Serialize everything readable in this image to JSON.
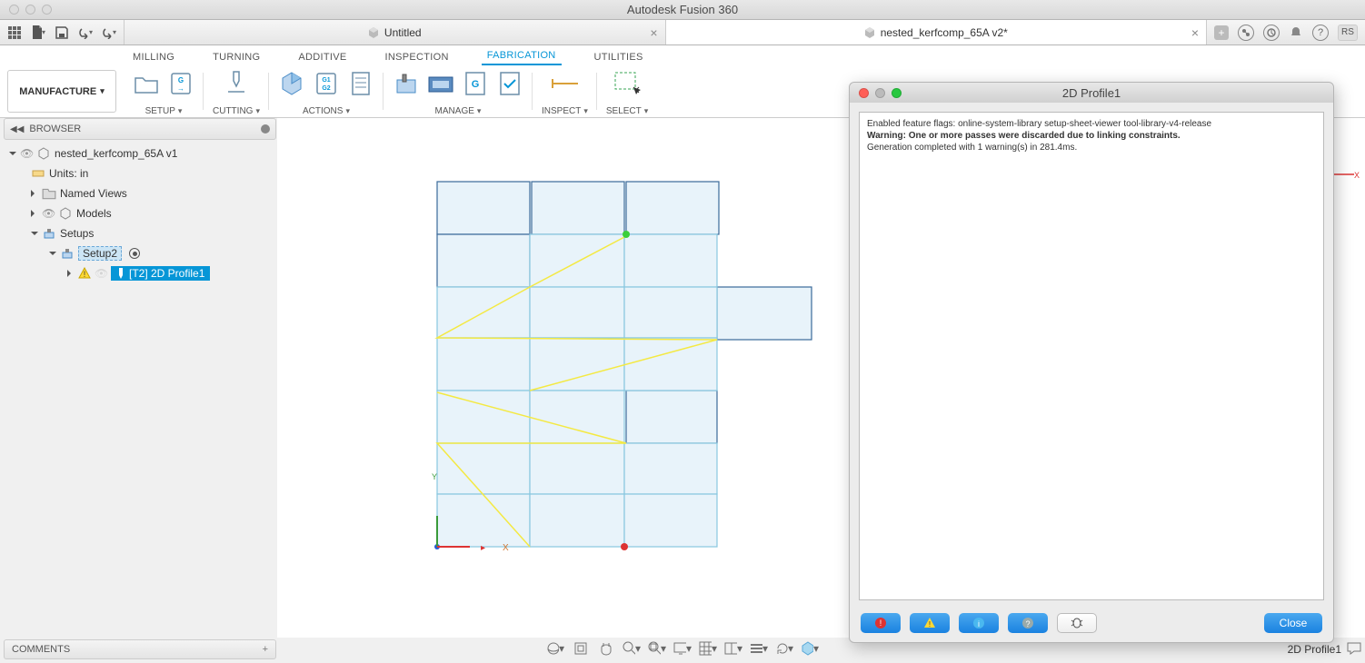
{
  "app_title": "Autodesk Fusion 360",
  "tabs": [
    {
      "label": "Untitled",
      "active": false
    },
    {
      "label": "nested_kerfcomp_65A v2*",
      "active": true
    }
  ],
  "avatar_initials": "RS",
  "workspace": "MANUFACTURE",
  "ribbon_tabs": [
    "MILLING",
    "TURNING",
    "ADDITIVE",
    "INSPECTION",
    "FABRICATION",
    "UTILITIES"
  ],
  "ribbon_active_tab": "FABRICATION",
  "ribbon_groups": {
    "setup": "SETUP",
    "cutting": "CUTTING",
    "actions": "ACTIONS",
    "manage": "MANAGE",
    "inspect": "INSPECT",
    "select": "SELECT"
  },
  "browser": {
    "title": "BROWSER",
    "root": "nested_kerfcomp_65A v1",
    "units": "Units: in",
    "named_views": "Named Views",
    "models": "Models",
    "setups": "Setups",
    "setup2": "Setup2",
    "operation": "[T2] 2D Profile1"
  },
  "log_window": {
    "title": "2D Profile1",
    "line1": "Enabled feature flags: online-system-library setup-sheet-viewer tool-library-v4-release",
    "line2": "Warning: One or more passes were discarded due to linking constraints.",
    "line3": "Generation completed with 1 warning(s) in 281.4ms.",
    "close_label": "Close"
  },
  "comments_label": "COMMENTS",
  "status_text": "2D Profile1",
  "gizmo": {
    "x_label": "X",
    "y_label": "Y"
  }
}
